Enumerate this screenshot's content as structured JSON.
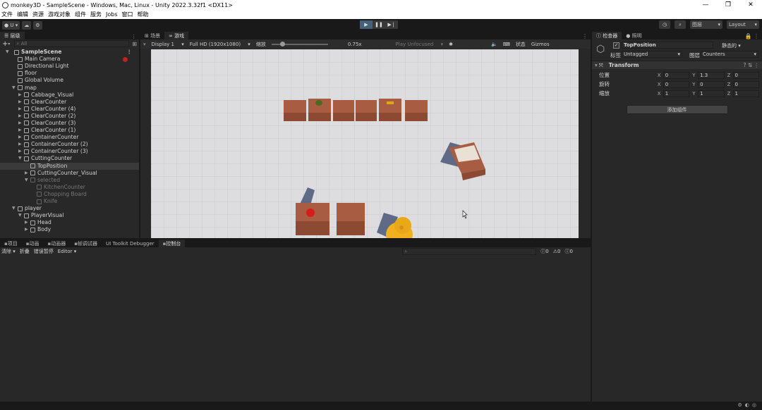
{
  "window": {
    "title": "monkey3D - SampleScene - Windows, Mac, Linux - Unity 2022.3.32f1 <DX11>"
  },
  "menu": [
    "文件",
    "编辑",
    "资源",
    "游戏对象",
    "组件",
    "服务",
    "Jobs",
    "窗口",
    "帮助"
  ],
  "toolbar": {
    "account": "U",
    "layers": "图层",
    "layout": "Layout"
  },
  "hierarchy": {
    "tab": "层级",
    "search_placeholder": "All",
    "rows": [
      {
        "label": "SampleScene",
        "indent": 0,
        "arrow": "▼",
        "type": "scene"
      },
      {
        "label": "Main Camera",
        "indent": 1,
        "arrow": "",
        "type": "obj"
      },
      {
        "label": "Directional Light",
        "indent": 1,
        "arrow": "",
        "type": "obj"
      },
      {
        "label": "floor",
        "indent": 1,
        "arrow": "",
        "type": "obj"
      },
      {
        "label": "Global Volume",
        "indent": 1,
        "arrow": "",
        "type": "obj"
      },
      {
        "label": "map",
        "indent": 1,
        "arrow": "▼",
        "type": "obj"
      },
      {
        "label": "Cabbage_Visual",
        "indent": 2,
        "arrow": "▶",
        "type": "obj"
      },
      {
        "label": "ClearCounter",
        "indent": 2,
        "arrow": "▶",
        "type": "obj"
      },
      {
        "label": "ClearCounter (4)",
        "indent": 2,
        "arrow": "▶",
        "type": "obj"
      },
      {
        "label": "ClearCounter (2)",
        "indent": 2,
        "arrow": "▶",
        "type": "obj"
      },
      {
        "label": "ClearCounter (3)",
        "indent": 2,
        "arrow": "▶",
        "type": "obj"
      },
      {
        "label": "ClearCounter (1)",
        "indent": 2,
        "arrow": "▶",
        "type": "obj"
      },
      {
        "label": "ContainerCounter",
        "indent": 2,
        "arrow": "▶",
        "type": "obj"
      },
      {
        "label": "ContainerCounter (2)",
        "indent": 2,
        "arrow": "▶",
        "type": "obj"
      },
      {
        "label": "ContainerCounter (3)",
        "indent": 2,
        "arrow": "▶",
        "type": "obj"
      },
      {
        "label": "CuttingCounter",
        "indent": 2,
        "arrow": "▼",
        "type": "obj"
      },
      {
        "label": "TopPosition",
        "indent": 3,
        "arrow": "",
        "type": "sel"
      },
      {
        "label": "CuttingCounter_Visual",
        "indent": 3,
        "arrow": "▶",
        "type": "obj"
      },
      {
        "label": "selected",
        "indent": 3,
        "arrow": "▼",
        "type": "dim"
      },
      {
        "label": "KitchenCounter",
        "indent": 4,
        "arrow": "",
        "type": "dim"
      },
      {
        "label": "Chopping Board",
        "indent": 4,
        "arrow": "",
        "type": "dim"
      },
      {
        "label": "Knife",
        "indent": 4,
        "arrow": "",
        "type": "dim"
      },
      {
        "label": "player",
        "indent": 1,
        "arrow": "▼",
        "type": "obj"
      },
      {
        "label": "PlayerVisual",
        "indent": 2,
        "arrow": "▼",
        "type": "obj"
      },
      {
        "label": "Head",
        "indent": 3,
        "arrow": "▶",
        "type": "obj"
      },
      {
        "label": "Body",
        "indent": 3,
        "arrow": "▶",
        "type": "obj"
      }
    ]
  },
  "scene": {
    "tabs": [
      "场景",
      "游戏"
    ],
    "display": "Display 1",
    "resolution": "Full HD (1920x1080)",
    "scale_label": "缩放",
    "scale_value": "0.75x",
    "play_mode": "Play Unfocused",
    "stats": "状态",
    "gizmos": "Gizmos"
  },
  "inspector": {
    "tabs": [
      "检查器",
      "照明"
    ],
    "object_name": "TopPosition",
    "static_label": "静态的",
    "tag_label": "标签",
    "tag_value": "Untagged",
    "layer_label": "图层",
    "layer_value": "Counters",
    "component": "Transform",
    "rows": [
      {
        "label": "位置",
        "x": "0",
        "y": "1.3",
        "z": "0"
      },
      {
        "label": "旋转",
        "x": "0",
        "y": "0",
        "z": "0"
      },
      {
        "label": "缩放",
        "x": "1",
        "y": "1",
        "z": "1"
      }
    ],
    "add_component": "添加组件"
  },
  "console": {
    "tabs": [
      "项目",
      "动画",
      "动画器",
      "帧调试器",
      "UI Toolkit Debugger",
      "控制台"
    ],
    "clear": "清除",
    "collapse": "折叠",
    "error_pause": "错误暂停",
    "editor": "Editor",
    "counts": [
      "0",
      "0",
      "0"
    ]
  }
}
